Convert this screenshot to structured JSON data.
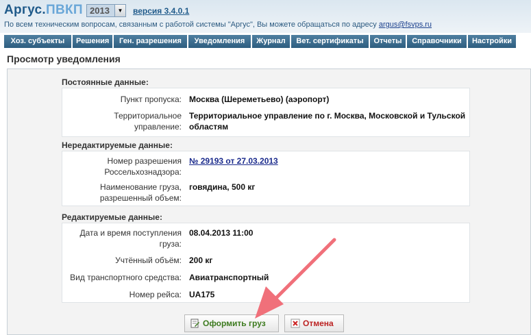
{
  "header": {
    "logo_main": "Аргус.",
    "logo_sub": "ПВКП",
    "year": "2013",
    "version": "версия 3.4.0.1",
    "support_text": "По всем техническим вопросам, связанным с работой системы \"Аргус\", Вы можете обращаться по адресу ",
    "support_email": "argus@fsvps.ru"
  },
  "menu": [
    "Хоз. субъекты",
    "Решения",
    "Ген. разрешения",
    "Уведомления",
    "Журнал",
    "Вет. сертификаты",
    "Отчеты",
    "Справочники",
    "Настройки"
  ],
  "page": {
    "title": "Просмотр уведомления"
  },
  "sections": {
    "permanent": {
      "title": "Постоянные данные:",
      "checkpoint_label": "Пункт пропуска:",
      "checkpoint_value": "Москва (Шереметьево) (аэропорт)",
      "territorial_label_1": "Территориальное",
      "territorial_label_2": "управление:",
      "territorial_value_1": "Территориальное управление по г. Москва, Московской и Тульской",
      "territorial_value_2": "областям"
    },
    "readonly": {
      "title": "Нередактируемые данные:",
      "permit_label_1": "Номер разрешения",
      "permit_label_2": "Россельхознадзора:",
      "permit_value": "№ 29193 от 27.03.2013",
      "cargo_label_1": "Наименование груза,",
      "cargo_label_2": "разрешенный объем:",
      "cargo_value": "говядина, 500 кг"
    },
    "editable": {
      "title": "Редактируемые данные:",
      "arrival_label_1": "Дата и время поступления",
      "arrival_label_2": "груза:",
      "arrival_value": "08.04.2013 11:00",
      "volume_label": "Учтённый объём:",
      "volume_value": "200 кг",
      "transport_label": "Вид транспортного средства:",
      "transport_value": "Авиатранспортный",
      "flight_label": "Номер рейса:",
      "flight_value": "UA175"
    }
  },
  "buttons": {
    "submit": "Оформить груз",
    "cancel": "Отмена"
  },
  "colors": {
    "menu_bg": "#3d6d90",
    "arrow": "#f0707a",
    "submit_text": "#3c7a1e",
    "cancel_text": "#bb2222",
    "link": "#1a2a8c"
  }
}
